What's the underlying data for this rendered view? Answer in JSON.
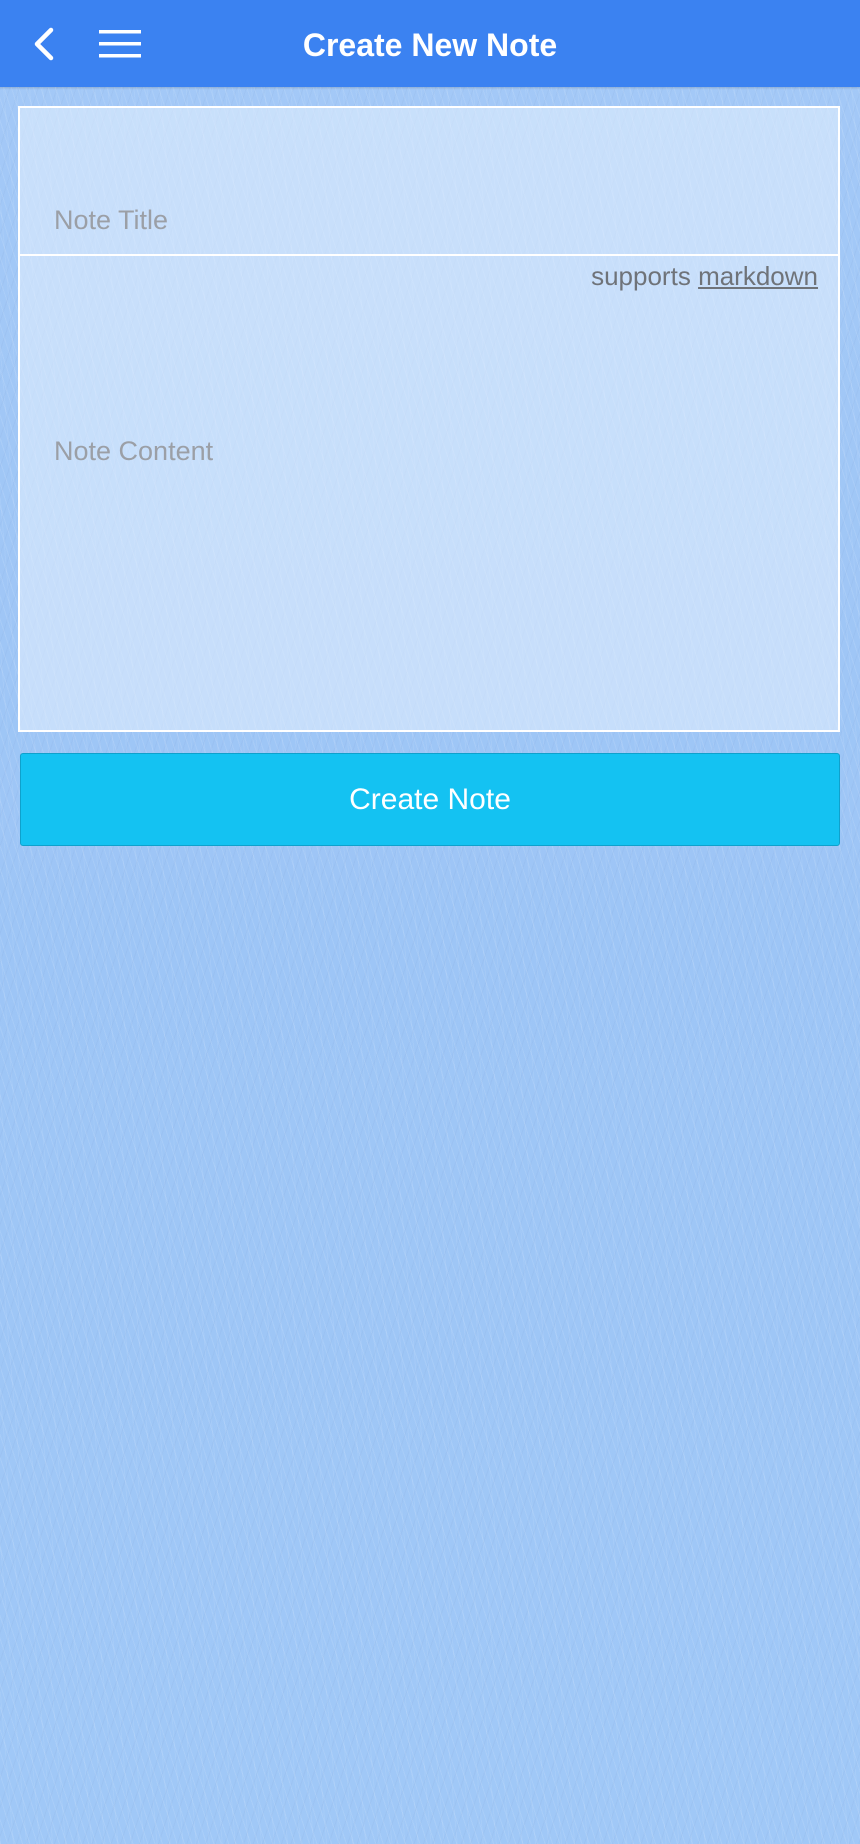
{
  "header": {
    "title": "Create New Note",
    "back_icon": "chevron-left-icon",
    "menu_icon": "hamburger-menu-icon",
    "background_color": "#3b82f1"
  },
  "form": {
    "title_placeholder": "Note Title",
    "title_value": "",
    "content_placeholder": "Note Content",
    "content_value": "",
    "hint_text": "supports",
    "hint_link": "markdown"
  },
  "actions": {
    "create_label": "Create Note",
    "create_color": "#14c2f2"
  }
}
